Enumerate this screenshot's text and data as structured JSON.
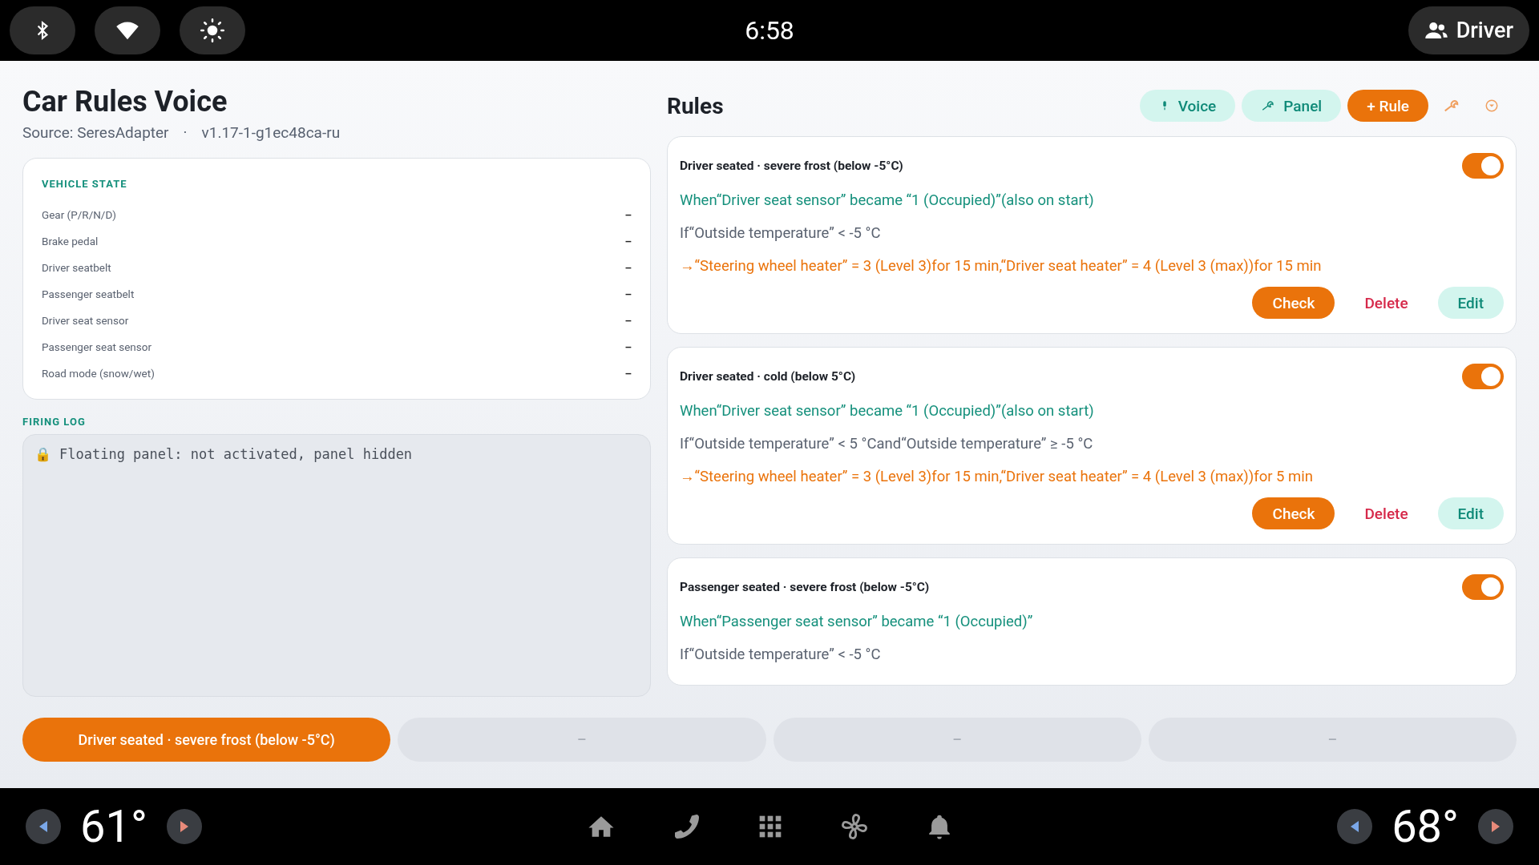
{
  "status_bar": {
    "time": "6:58",
    "profile": "Driver"
  },
  "app": {
    "title": "Car Rules Voice",
    "source": "Source: SeresAdapter",
    "separator": "·",
    "version": "v1.17-1-g1ec48ca-ru"
  },
  "vehicle_state": {
    "heading": "VEHICLE STATE",
    "rows": [
      {
        "label": "Gear (P/R/N/D)",
        "value": "–"
      },
      {
        "label": "Brake pedal",
        "value": "–"
      },
      {
        "label": "Driver seatbelt",
        "value": "–"
      },
      {
        "label": "Passenger seatbelt",
        "value": "–"
      },
      {
        "label": "Driver seat sensor",
        "value": "–"
      },
      {
        "label": "Passenger seat sensor",
        "value": "–"
      },
      {
        "label": "Road mode (snow/wet)",
        "value": "–"
      }
    ]
  },
  "firing_log": {
    "heading": "FIRING LOG",
    "icon": "🔒",
    "text": "Floating panel: not activated, panel hidden"
  },
  "rules": {
    "heading": "Rules",
    "buttons": [
      {
        "label": "Voice",
        "kind": "voice"
      },
      {
        "label": "Panel",
        "kind": "panel"
      },
      {
        "label": "+ Rule",
        "kind": "add"
      }
    ],
    "items": [
      {
        "title": "Driver seated · severe frost (below -5°C)",
        "on": true,
        "when": "When“Driver seat sensor” became “1 (Occupied)”(also on start)",
        "if": "If“Outside temperature” < -5 °C",
        "then": "→“Steering wheel heater” = 3 (Level 3)for 15 min,“Driver seat heater” = 4 (Level 3 (max))for 15 min",
        "actions": [
          "Check",
          "Delete",
          "Edit"
        ]
      },
      {
        "title": "Driver seated · cold (below 5°C)",
        "on": true,
        "when": "When“Driver seat sensor” became “1 (Occupied)”(also on start)",
        "if": "If“Outside temperature” < 5 °Cand“Outside temperature” ≥ -5 °C",
        "then": "→“Steering wheel heater” = 3 (Level 3)for 15 min,“Driver seat heater” = 4 (Level 3 (max))for 5 min",
        "actions": [
          "Check",
          "Delete",
          "Edit"
        ]
      },
      {
        "title": "Passenger seated · severe frost (below -5°C)",
        "on": true,
        "when": "When“Passenger seat sensor” became “1 (Occupied)”",
        "if": "If“Outside temperature” < -5 °C"
      }
    ]
  },
  "quick_slots": [
    {
      "label": "Driver seated · severe frost (below -5°C)",
      "selected": true
    },
    {
      "label": "–",
      "selected": false
    },
    {
      "label": "–",
      "selected": false
    },
    {
      "label": "–",
      "selected": false
    }
  ],
  "climate": {
    "left_temp": "61°",
    "right_temp": "68°"
  }
}
